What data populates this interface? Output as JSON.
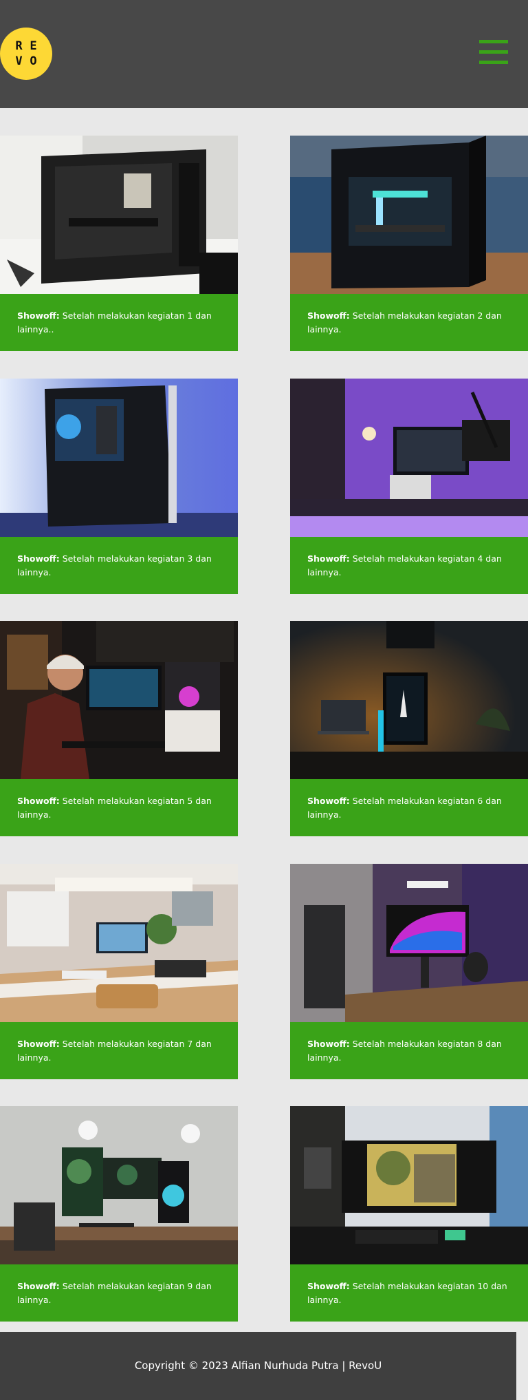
{
  "header": {
    "logo_letters": [
      "R",
      "E",
      "V",
      "O"
    ],
    "menu_icon": "hamburger-menu-icon",
    "accent_color": "#3aa318",
    "logo_color": "#fdd835"
  },
  "cards": [
    {
      "title": "Showoff:",
      "text": "Setelah melakukan kegiatan 1 dan lainnya..",
      "image": "pc-case-interior-photo"
    },
    {
      "title": "Showoff:",
      "text": "Setelah melakukan kegiatan 2 dan lainnya.",
      "image": "gaming-pc-rgb-photo"
    },
    {
      "title": "Showoff:",
      "text": "Setelah melakukan kegiatan 3 dan lainnya.",
      "image": "pc-case-blue-light-photo"
    },
    {
      "title": "Showoff:",
      "text": "Setelah melakukan kegiatan 4 dan lainnya.",
      "image": "purple-desk-setup-photo"
    },
    {
      "title": "Showoff:",
      "text": "Setelah melakukan kegiatan 5 dan lainnya.",
      "image": "man-at-desk-photo"
    },
    {
      "title": "Showoff:",
      "text": "Setelah melakukan kegiatan 6 dan lainnya.",
      "image": "dark-desk-monitor-photo"
    },
    {
      "title": "Showoff:",
      "text": "Setelah melakukan kegiatan 7 dan lainnya.",
      "image": "bright-desk-setup-photo"
    },
    {
      "title": "Showoff:",
      "text": "Setelah melakukan kegiatan 8 dan lainnya.",
      "image": "purple-monitor-setup-photo"
    },
    {
      "title": "Showoff:",
      "text": "Setelah melakukan kegiatan 9 dan lainnya.",
      "image": "plant-wallpaper-setup-photo"
    },
    {
      "title": "Showoff:",
      "text": "Setelah melakukan kegiatan 10 dan lainnya.",
      "image": "window-desk-setup-photo"
    }
  ],
  "footer": {
    "copyright": "Copyright © 2023 Alfian Nurhuda Putra | RevoU"
  }
}
